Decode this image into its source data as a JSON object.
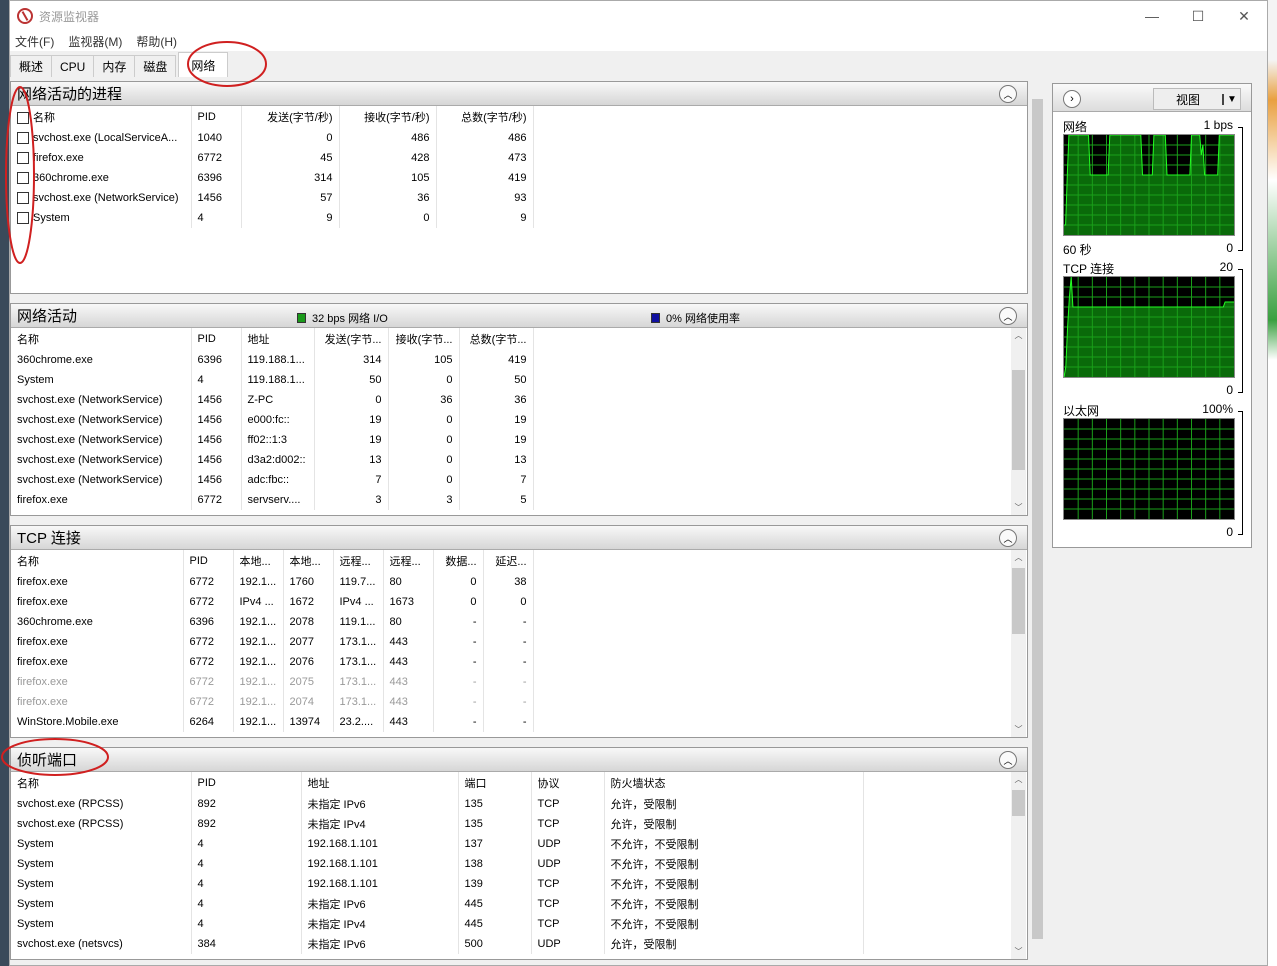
{
  "window": {
    "title": "资源监视器",
    "minimize": "—",
    "maximize": "☐",
    "close": "✕"
  },
  "menu": [
    "文件(F)",
    "监视器(M)",
    "帮助(H)"
  ],
  "tabs": [
    {
      "label": "概述"
    },
    {
      "label": "CPU"
    },
    {
      "label": "内存"
    },
    {
      "label": "磁盘"
    },
    {
      "label": "网络",
      "active": true
    }
  ],
  "colors": {
    "graph_bg": "#000000",
    "graph_grid": "#1aa01a",
    "graph_fill": "#0a6a0a",
    "graph_line": "#22ff22",
    "io_legend": "#1a9a1a",
    "usage_legend": "#1010a0",
    "annotation": "#d02020"
  },
  "processes": {
    "title": "网络活动的进程",
    "columns": [
      "名称",
      "PID",
      "发送(字节/秒)",
      "接收(字节/秒)",
      "总数(字节/秒)"
    ],
    "rows": [
      [
        "svchost.exe (LocalServiceA...",
        "1040",
        "0",
        "486",
        "486"
      ],
      [
        "firefox.exe",
        "6772",
        "45",
        "428",
        "473"
      ],
      [
        "360chrome.exe",
        "6396",
        "314",
        "105",
        "419"
      ],
      [
        "svchost.exe (NetworkService)",
        "1456",
        "57",
        "36",
        "93"
      ],
      [
        "System",
        "4",
        "9",
        "0",
        "9"
      ]
    ]
  },
  "activity": {
    "title": "网络活动",
    "io_legend": "32 bps 网络 I/O",
    "usage_legend": "0% 网络使用率",
    "columns": [
      "名称",
      "PID",
      "地址",
      "发送(字节...",
      "接收(字节...",
      "总数(字节..."
    ],
    "rows": [
      [
        "360chrome.exe",
        "6396",
        "119.188.1...",
        "314",
        "105",
        "419"
      ],
      [
        "System",
        "4",
        "119.188.1...",
        "50",
        "0",
        "50"
      ],
      [
        "svchost.exe (NetworkService)",
        "1456",
        "Z-PC",
        "0",
        "36",
        "36"
      ],
      [
        "svchost.exe (NetworkService)",
        "1456",
        "e000:fc::",
        "19",
        "0",
        "19"
      ],
      [
        "svchost.exe (NetworkService)",
        "1456",
        "ff02::1:3",
        "19",
        "0",
        "19"
      ],
      [
        "svchost.exe (NetworkService)",
        "1456",
        "d3a2:d002::",
        "13",
        "0",
        "13"
      ],
      [
        "svchost.exe (NetworkService)",
        "1456",
        "adc:fbc::",
        "7",
        "0",
        "7"
      ],
      [
        "firefox.exe",
        "6772",
        "servserv....",
        "3",
        "3",
        "5"
      ]
    ]
  },
  "tcp": {
    "title": "TCP 连接",
    "columns": [
      "名称",
      "PID",
      "本地...",
      "本地...",
      "远程...",
      "远程...",
      "数据...",
      "延迟..."
    ],
    "rows": [
      [
        "firefox.exe",
        "6772",
        "192.1...",
        "1760",
        "119.7...",
        "80",
        "0",
        "38"
      ],
      [
        "firefox.exe",
        "6772",
        "IPv4 ...",
        "1672",
        "IPv4 ...",
        "1673",
        "0",
        "0"
      ],
      [
        "360chrome.exe",
        "6396",
        "192.1...",
        "2078",
        "119.1...",
        "80",
        "-",
        "-"
      ],
      [
        "firefox.exe",
        "6772",
        "192.1...",
        "2077",
        "173.1...",
        "443",
        "-",
        "-"
      ],
      [
        "firefox.exe",
        "6772",
        "192.1...",
        "2076",
        "173.1...",
        "443",
        "-",
        "-"
      ],
      [
        "firefox.exe",
        "6772",
        "192.1...",
        "2075",
        "173.1...",
        "443",
        "-",
        "-"
      ],
      [
        "firefox.exe",
        "6772",
        "192.1...",
        "2074",
        "173.1...",
        "443",
        "-",
        "-"
      ],
      [
        "WinStore.Mobile.exe",
        "6264",
        "192.1...",
        "13974",
        "23.2....",
        "443",
        "-",
        "-"
      ]
    ],
    "dimmed_rows": [
      5,
      6
    ]
  },
  "listening": {
    "title": "侦听端口",
    "columns": [
      "名称",
      "PID",
      "地址",
      "端口",
      "协议",
      "防火墙状态"
    ],
    "rows": [
      [
        "svchost.exe (RPCSS)",
        "892",
        "未指定 IPv6",
        "135",
        "TCP",
        "允许，受限制"
      ],
      [
        "svchost.exe (RPCSS)",
        "892",
        "未指定 IPv4",
        "135",
        "TCP",
        "允许，受限制"
      ],
      [
        "System",
        "4",
        "192.168.1.101",
        "137",
        "UDP",
        "不允许，不受限制"
      ],
      [
        "System",
        "4",
        "192.168.1.101",
        "138",
        "UDP",
        "不允许，不受限制"
      ],
      [
        "System",
        "4",
        "192.168.1.101",
        "139",
        "TCP",
        "不允许，不受限制"
      ],
      [
        "System",
        "4",
        "未指定 IPv6",
        "445",
        "TCP",
        "不允许，不受限制"
      ],
      [
        "System",
        "4",
        "未指定 IPv4",
        "445",
        "TCP",
        "不允许，不受限制"
      ],
      [
        "svchost.exe (netsvcs)",
        "384",
        "未指定 IPv6",
        "500",
        "UDP",
        "允许，受限制"
      ]
    ]
  },
  "side": {
    "view_label": "视图",
    "graphs": [
      {
        "name": "网络",
        "max": "1 bps",
        "time": "60 秒",
        "min": "0",
        "series": [
          10,
          10,
          60,
          100,
          100,
          100,
          100,
          100,
          100,
          100,
          100,
          100,
          100,
          100,
          100,
          100,
          60,
          60,
          60,
          60,
          60,
          60,
          60,
          60,
          60,
          60,
          60,
          60,
          100,
          100,
          100,
          100,
          100,
          100,
          100,
          100,
          100,
          100,
          100,
          100,
          100,
          100,
          100,
          100,
          100,
          100,
          100,
          100,
          60,
          60,
          60,
          60,
          60,
          60,
          60,
          100,
          100,
          100,
          100,
          100,
          100,
          100,
          100,
          60,
          60,
          60,
          60,
          60,
          60,
          60,
          60,
          60,
          60,
          60,
          60,
          60,
          60,
          60,
          100,
          100,
          100,
          100,
          100,
          100,
          80,
          90,
          60,
          60,
          60,
          60,
          60,
          60,
          60,
          60,
          60,
          100,
          100,
          100,
          100,
          100,
          100,
          100,
          100,
          100,
          100
        ]
      },
      {
        "name": "TCP 连接",
        "max": "20",
        "min": "0",
        "series": [
          0,
          10,
          50,
          80,
          100,
          70,
          70,
          70,
          70,
          70,
          70,
          70,
          70,
          70,
          70,
          70,
          70,
          70,
          70,
          70,
          70,
          70,
          70,
          70,
          70,
          70,
          70,
          70,
          70,
          70,
          70,
          70,
          70,
          70,
          70,
          70,
          70,
          70,
          70,
          70,
          70,
          70,
          70,
          70,
          70,
          70,
          70,
          70,
          70,
          70,
          70,
          70,
          70,
          70,
          70,
          70,
          70,
          70,
          70,
          70,
          70,
          70,
          70,
          70,
          70,
          70,
          70,
          70,
          70,
          70,
          70,
          70,
          70,
          70,
          70,
          70,
          70,
          70,
          70,
          70,
          70,
          70,
          70,
          70,
          70,
          70,
          70,
          70,
          70,
          70,
          75,
          75,
          75,
          75,
          75,
          75
        ]
      },
      {
        "name": "以太网",
        "max": "100%",
        "min": "0",
        "series": [
          0,
          0,
          0,
          0,
          0,
          0,
          0,
          0,
          0,
          0
        ]
      }
    ]
  }
}
